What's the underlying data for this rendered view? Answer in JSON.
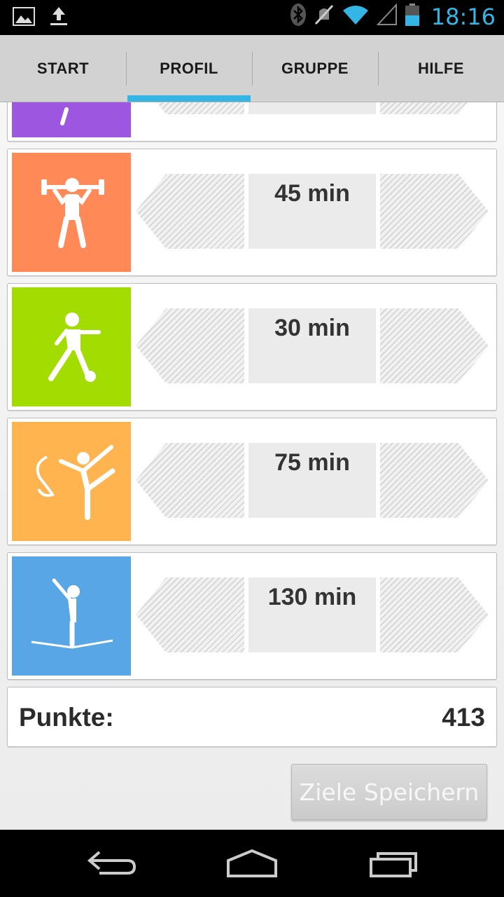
{
  "status_bar": {
    "time": "18:16",
    "left_icons": [
      "gallery-icon",
      "upload-icon"
    ],
    "right_icons": [
      "bluetooth-icon",
      "mute-icon",
      "wifi-icon",
      "signal-icon",
      "battery-icon"
    ]
  },
  "tabs": [
    {
      "label": "START",
      "active": false
    },
    {
      "label": "PROFIL",
      "active": true
    },
    {
      "label": "GRUPPE",
      "active": false
    },
    {
      "label": "HILFE",
      "active": false
    }
  ],
  "activities": [
    {
      "icon": "gymnastics-icon",
      "color": "#9c56e0",
      "value": ""
    },
    {
      "icon": "weightlifting-icon",
      "color": "#ff8a58",
      "value": "45 min"
    },
    {
      "icon": "soccer-icon",
      "color": "#a3dc00",
      "value": "30 min"
    },
    {
      "icon": "rhythmic-gymnastics-icon",
      "color": "#ffb44f",
      "value": "75 min"
    },
    {
      "icon": "slackline-icon",
      "color": "#58a6e6",
      "value": "130 min"
    }
  ],
  "score": {
    "label": "Punkte:",
    "value": "413"
  },
  "save_button": {
    "label": "Ziele Speichern"
  },
  "colors": {
    "accent": "#33b5e5"
  },
  "nav": [
    "back-icon",
    "home-icon",
    "recent-apps-icon"
  ]
}
